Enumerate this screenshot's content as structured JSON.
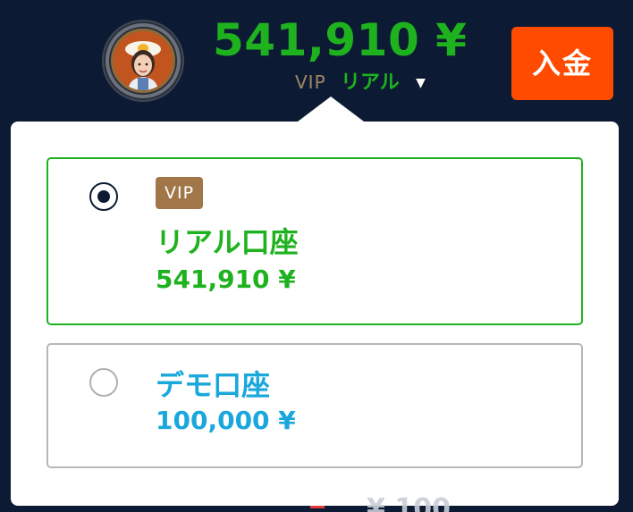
{
  "header": {
    "balance": "541,910 ¥",
    "account_switch": {
      "vip_label": "VIP",
      "account_name": "リアル",
      "caret": "▼"
    },
    "deposit_label": "入金"
  },
  "dropdown": {
    "accounts": [
      {
        "badge": "VIP",
        "title": "リアル口座",
        "amount": "541,910 ¥",
        "selected": true,
        "color": "#1fb21f"
      },
      {
        "title": "デモ口座",
        "amount": "100,000 ¥",
        "selected": false,
        "color": "#1aa7dc"
      }
    ]
  },
  "background": {
    "peek_text": "¥ 100"
  },
  "colors": {
    "header_bg": "#0c1b33",
    "accent_green": "#1fb21f",
    "deposit_orange": "#ff4b00",
    "vip_badge": "#a1774a",
    "demo_blue": "#1aa7dc"
  },
  "icons": [
    "avatar-icon",
    "caret-down-icon",
    "radio-selected-icon",
    "radio-unselected-icon"
  ]
}
